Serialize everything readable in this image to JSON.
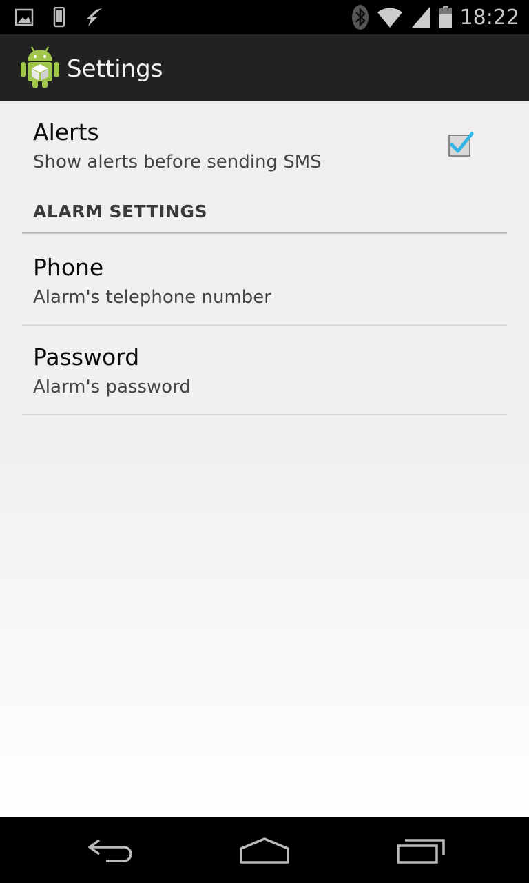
{
  "status_bar": {
    "time": "18:22",
    "left_icons": [
      "image-notification-icon",
      "phone-notification-icon",
      "flash-notification-icon"
    ],
    "right_icons": [
      "bluetooth-icon",
      "wifi-icon",
      "signal-icon",
      "battery-icon"
    ]
  },
  "action_bar": {
    "title": "Settings",
    "icon": "android-app-icon"
  },
  "preferences": {
    "alerts": {
      "title": "Alerts",
      "summary": "Show alerts before sending SMS",
      "checked": true
    },
    "category": "ALARM SETTINGS",
    "phone": {
      "title": "Phone",
      "summary": "Alarm's telephone number"
    },
    "password": {
      "title": "Password",
      "summary": "Alarm's password"
    }
  },
  "navigation": {
    "buttons": [
      "back-icon",
      "home-icon",
      "recent-apps-icon"
    ]
  },
  "colors": {
    "accent": "#33b5e5",
    "action_bar": "#222222",
    "background": "#f0f0f0"
  }
}
